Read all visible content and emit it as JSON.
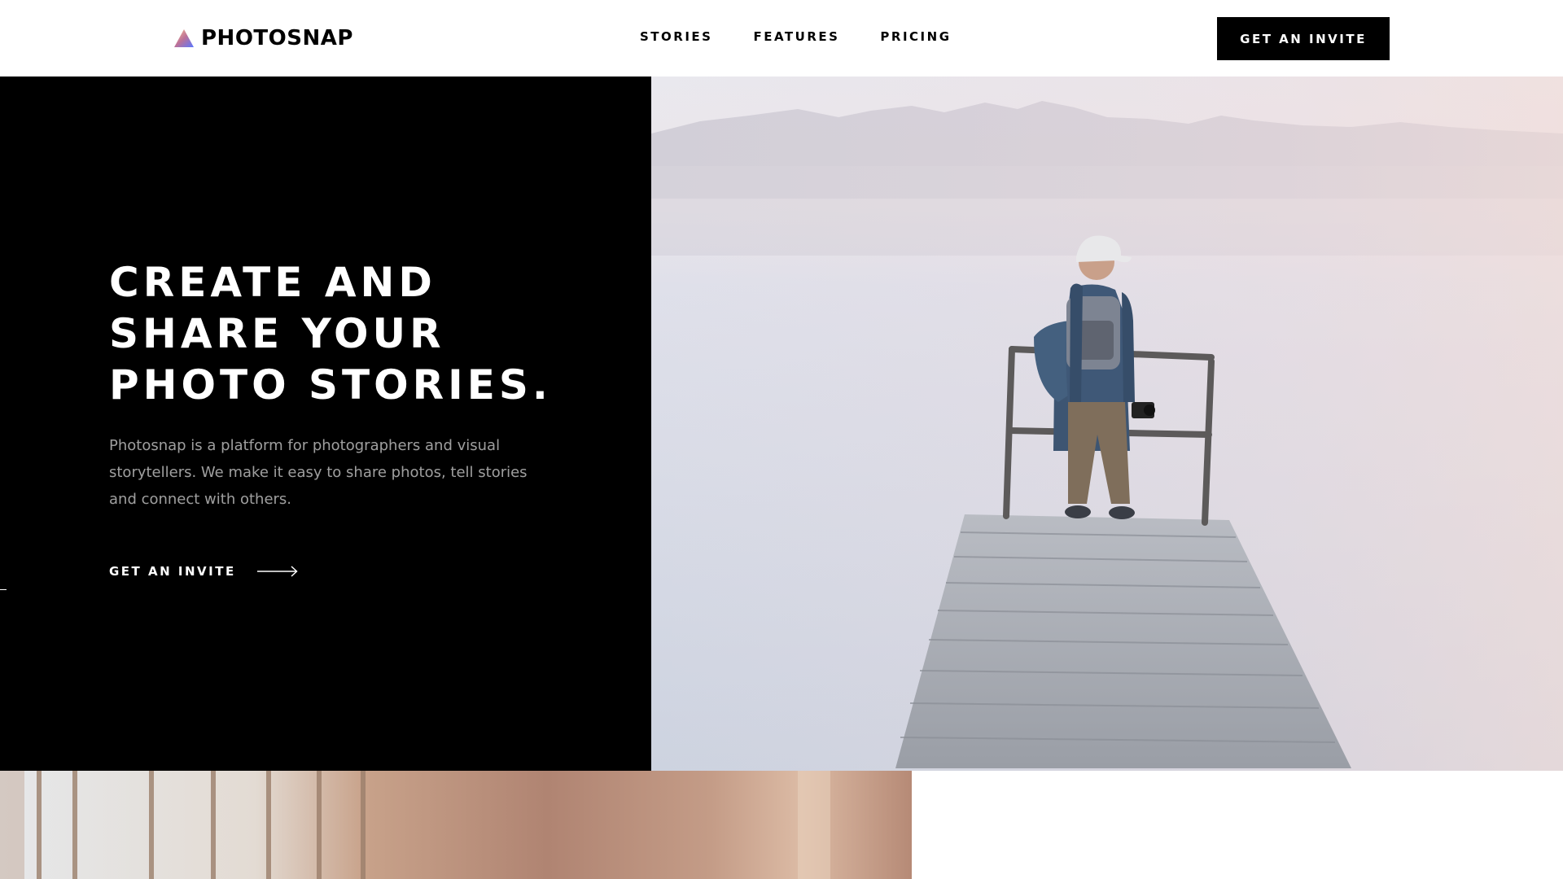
{
  "header": {
    "brand": "PHOTOSNAP",
    "logo_icon": "triangle-gradient-icon",
    "nav": [
      {
        "label": "STORIES"
      },
      {
        "label": "FEATURES"
      },
      {
        "label": "PRICING"
      }
    ],
    "cta_label": "GET AN INVITE"
  },
  "hero": {
    "title_lines": [
      "CREATE AND",
      "SHARE YOUR",
      "PHOTO STORIES."
    ],
    "description": "Photosnap is a platform for photographers and visual storytellers. We make it easy to share photos, tell stories and connect with others.",
    "cta_label": "GET AN INVITE",
    "cta_icon": "arrow-right-icon",
    "image": "man-on-pier-photo"
  },
  "next_section": {
    "image": "interior-photo"
  },
  "colors": {
    "background": "#ffffff",
    "hero_panel": "#000000",
    "text_primary": "#000000",
    "text_inverse": "#ffffff",
    "logo_gradient": [
      "#ffc593",
      "#bc7198",
      "#5a77ff"
    ]
  }
}
